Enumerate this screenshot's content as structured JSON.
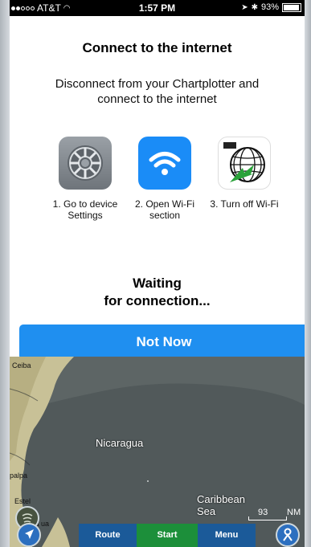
{
  "status_bar": {
    "carrier": "AT&T",
    "time": "1:57 PM",
    "battery": "93%",
    "battery_level": 0.93
  },
  "dialog": {
    "title": "Connect to the internet",
    "message": "Disconnect from your Chartplotter and connect to the internet",
    "steps": [
      {
        "label": "1. Go to device Settings",
        "icon": "settings-icon"
      },
      {
        "label": "2. Open Wi-Fi section",
        "icon": "wifi-icon"
      },
      {
        "label": "3. Turn off Wi-Fi",
        "icon": "chart-app-icon"
      }
    ],
    "waiting_line1": "Waiting",
    "waiting_line2": "for connection...",
    "not_now_label": "Not Now"
  },
  "map": {
    "labels": {
      "ceiba": "Ceiba",
      "nicaragua": "Nicaragua",
      "palpa": "palpa",
      "esteli": "Estel",
      "caribbean_1": "Caribbean",
      "caribbean_2": "Sea",
      "ma": "Ma    ua"
    },
    "scale_value": "93",
    "scale_unit": "NM"
  },
  "bottom_bar": {
    "route_label": "Route",
    "start_label": "Start",
    "menu_label": "Menu"
  },
  "colors": {
    "accent": "#1f8ff0",
    "start": "#1c8f3a",
    "bar": "#1b5a99"
  }
}
